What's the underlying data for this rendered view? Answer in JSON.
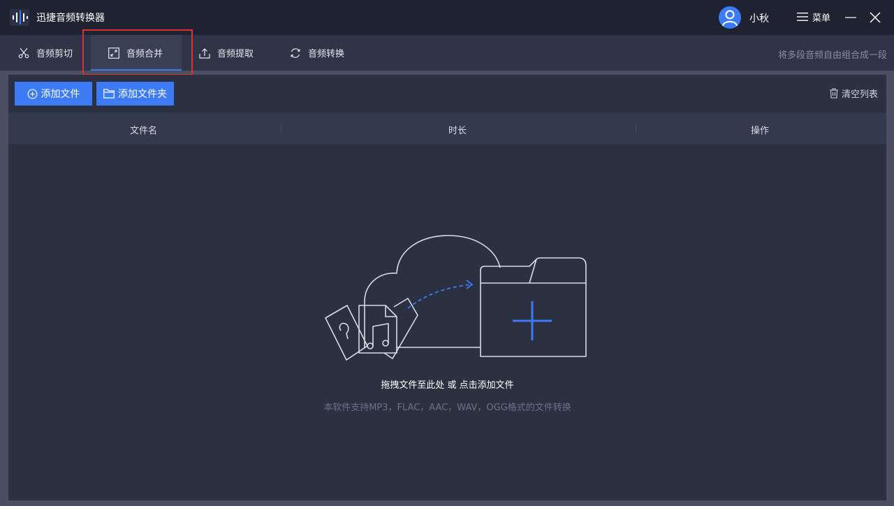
{
  "app": {
    "title": "迅捷音频转换器",
    "username": "小秋",
    "menu_label": "菜单"
  },
  "tabs": [
    {
      "label": "音频剪切",
      "icon": "scissors-icon"
    },
    {
      "label": "音频合并",
      "icon": "merge-icon",
      "active": true
    },
    {
      "label": "音频提取",
      "icon": "upload-icon"
    },
    {
      "label": "音频转换",
      "icon": "refresh-icon"
    }
  ],
  "tab_description": "将多段音频自由组合成一段",
  "toolbar": {
    "add_file": "添加文件",
    "add_folder": "添加文件夹",
    "clear_list": "清空列表"
  },
  "table": {
    "columns": [
      "文件名",
      "时长",
      "操作"
    ]
  },
  "empty_state": {
    "title": "拖拽文件至此处 或 点击添加文件",
    "subtitle": "本软件支持MP3，FLAC，AAC，WAV，OGG格式的文件转换"
  },
  "colors": {
    "accent": "#3d7bf5",
    "highlight": "#e0312d",
    "background": "#2c3142"
  }
}
